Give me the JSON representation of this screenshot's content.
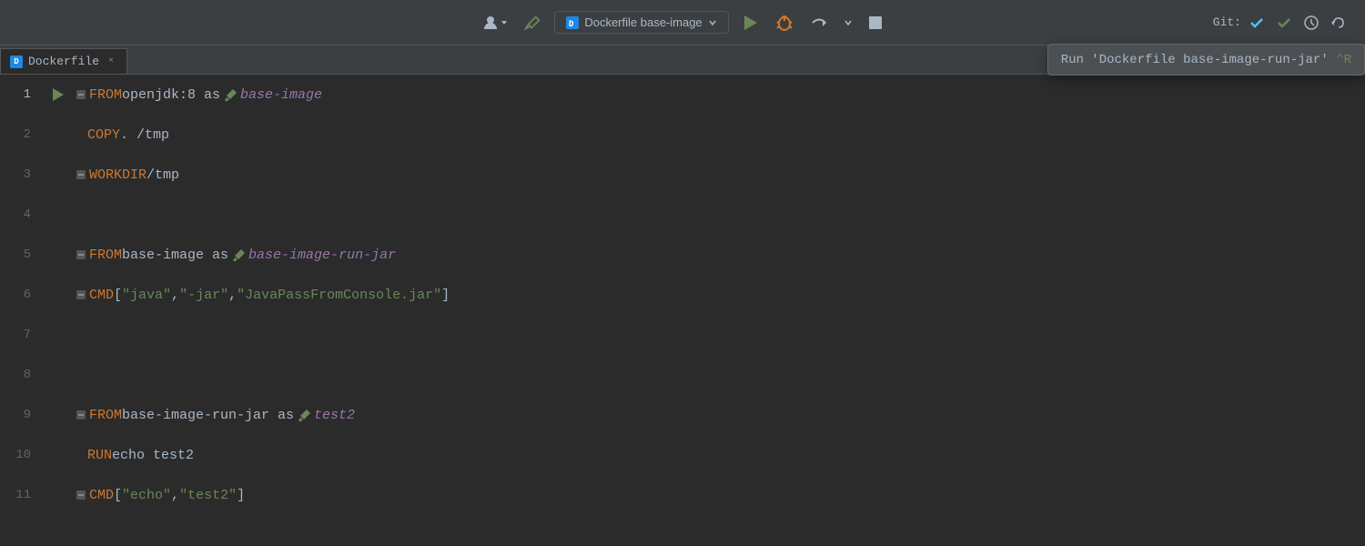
{
  "toolbar": {
    "run_config_label": "Dockerfile base-image",
    "git_label": "Git:",
    "tooltip_text": "Run 'Dockerfile base-image-run-jar'",
    "tooltip_shortcut": "^R"
  },
  "tab": {
    "label": "Dockerfile",
    "icon": "D",
    "close": "×"
  },
  "editor": {
    "lines": [
      {
        "number": "1",
        "has_run": true,
        "has_fold": true,
        "tokens": [
          {
            "text": "FROM",
            "class": "kw-from"
          },
          {
            "text": " openjdk:8 as ",
            "class": "plain"
          },
          {
            "text": "⚑",
            "class": "alias-green",
            "is_icon": true
          },
          {
            "text": " base-image",
            "class": "alias-purple"
          }
        ]
      },
      {
        "number": "2",
        "has_run": false,
        "has_fold": false,
        "tokens": [
          {
            "text": "    COPY",
            "class": "kw-copy"
          },
          {
            "text": " . /tmp",
            "class": "plain"
          }
        ]
      },
      {
        "number": "3",
        "has_run": false,
        "has_fold": true,
        "tokens": [
          {
            "text": "WORKDIR",
            "class": "kw-workdir"
          },
          {
            "text": " /tmp",
            "class": "plain"
          }
        ]
      },
      {
        "number": "4",
        "has_run": false,
        "has_fold": false,
        "tokens": []
      },
      {
        "number": "5",
        "has_run": false,
        "has_fold": true,
        "tokens": [
          {
            "text": "FROM",
            "class": "kw-from"
          },
          {
            "text": " base-image as ",
            "class": "plain"
          },
          {
            "text": "⚑",
            "class": "alias-green",
            "is_icon": true
          },
          {
            "text": " base-image-run-jar",
            "class": "alias-purple"
          }
        ]
      },
      {
        "number": "6",
        "has_run": false,
        "has_fold": true,
        "tokens": [
          {
            "text": "CMD",
            "class": "kw-cmd"
          },
          {
            "text": " [",
            "class": "plain"
          },
          {
            "text": "\"java\"",
            "class": "str-green"
          },
          {
            "text": ", ",
            "class": "plain"
          },
          {
            "text": "\"-jar\"",
            "class": "str-green"
          },
          {
            "text": ", ",
            "class": "plain"
          },
          {
            "text": "\"JavaPassFromConsole.jar\"",
            "class": "str-green"
          },
          {
            "text": "]",
            "class": "plain"
          }
        ]
      },
      {
        "number": "7",
        "has_run": false,
        "has_fold": false,
        "tokens": []
      },
      {
        "number": "8",
        "has_run": false,
        "has_fold": false,
        "tokens": []
      },
      {
        "number": "9",
        "has_run": false,
        "has_fold": true,
        "tokens": [
          {
            "text": "FROM",
            "class": "kw-from"
          },
          {
            "text": " base-image-run-jar as ",
            "class": "plain"
          },
          {
            "text": "⚑",
            "class": "alias-green",
            "is_icon": true
          },
          {
            "text": " test2",
            "class": "alias-purple"
          }
        ]
      },
      {
        "number": "10",
        "has_run": false,
        "has_fold": false,
        "tokens": [
          {
            "text": "    RUN",
            "class": "kw-run"
          },
          {
            "text": " echo test2",
            "class": "plain"
          }
        ]
      },
      {
        "number": "11",
        "has_run": false,
        "has_fold": true,
        "tokens": [
          {
            "text": "CMD",
            "class": "kw-cmd"
          },
          {
            "text": " [ ",
            "class": "plain"
          },
          {
            "text": "\"echo\"",
            "class": "str-green"
          },
          {
            "text": ", ",
            "class": "plain"
          },
          {
            "text": "\"test2\"",
            "class": "str-green"
          },
          {
            "text": "]",
            "class": "plain"
          }
        ]
      }
    ]
  }
}
